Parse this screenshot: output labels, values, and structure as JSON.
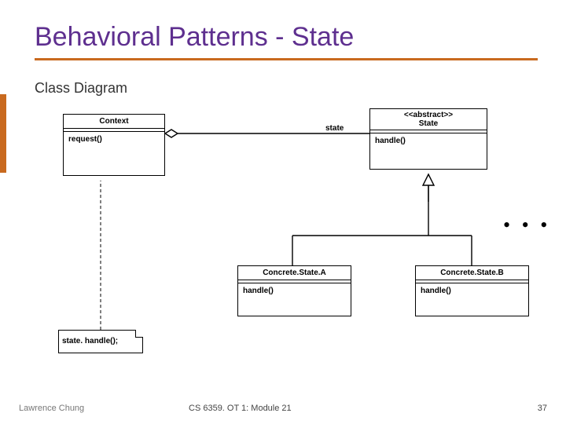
{
  "title": "Behavioral Patterns - State",
  "subtitle": "Class Diagram",
  "context": {
    "name": "Context",
    "op": "request()"
  },
  "state": {
    "stereo": "<<abstract>>",
    "name": "State",
    "op": "handle()"
  },
  "assoc_label": "state",
  "concreteA": {
    "name": "Concrete.State.A",
    "op": "handle()"
  },
  "concreteB": {
    "name": "Concrete.State.B",
    "op": "handle()"
  },
  "note": "state. handle();",
  "ellipsis": "• • •",
  "footer": {
    "left": "Lawrence Chung",
    "center": "CS 6359. OT 1: Module 21",
    "right": "37"
  }
}
